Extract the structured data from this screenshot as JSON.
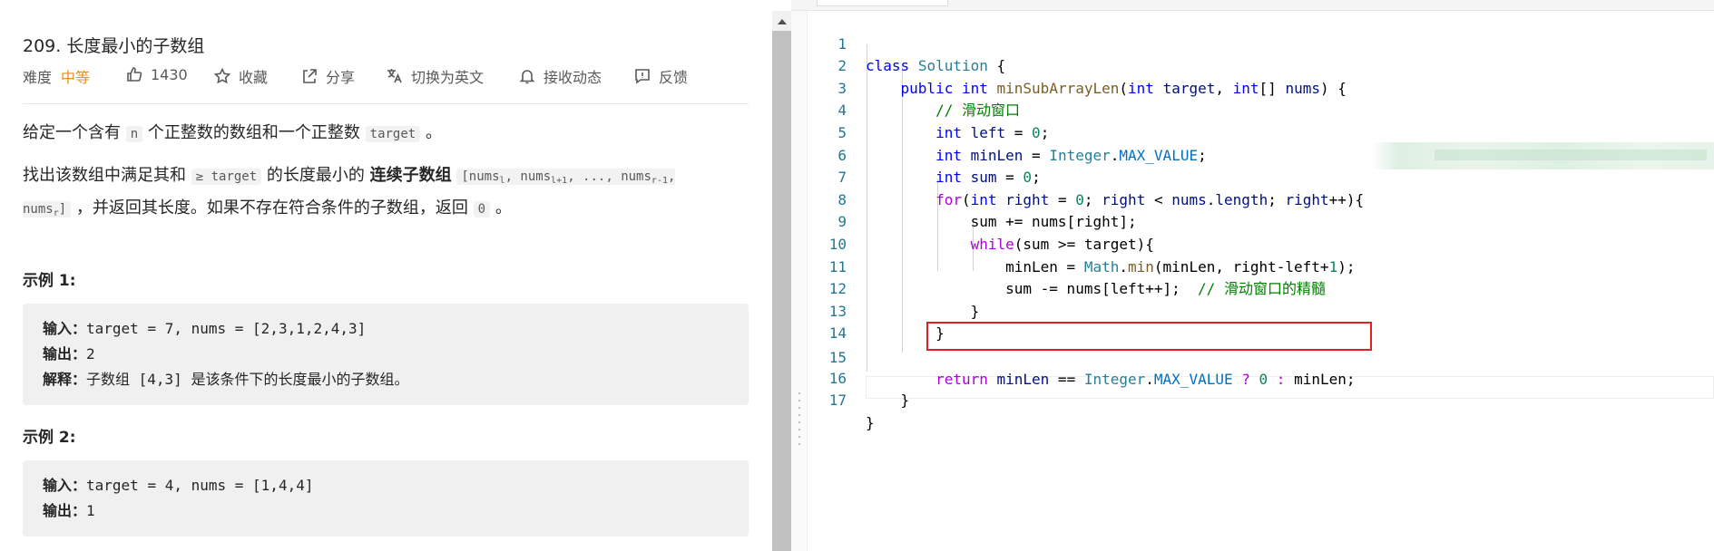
{
  "problem": {
    "title": "209. 长度最小的子数组",
    "difficulty_label": "难度",
    "difficulty_value": "中等",
    "likes": "1430",
    "favorite_label": "收藏",
    "share_label": "分享",
    "switch_lang_label": "切换为英文",
    "subscribe_label": "接收动态",
    "feedback_label": "反馈",
    "desc1": {
      "a": "给定一个含有",
      "n": "n",
      "b": "个正整数的数组和一个正整数",
      "target": "target",
      "c": "。"
    },
    "desc2": {
      "a": "找出该数组中满足其和",
      "cond": "≥ target",
      "b": "的长度最小的",
      "bold": "连续子数组",
      "seq_1": "[nums",
      "seq_1_sub": "l",
      "seq_2": ", nums",
      "seq_2_sub": "l+1",
      "seq_3": ", ..., nums",
      "seq_3_sub": "r-1",
      "seq_4": ", nums",
      "seq_4_sub": "r",
      "seq_5": "]",
      "c": "，并返回其长度。如果不存在符合条件的子数组，返回",
      "zero": "0",
      "d": "。"
    },
    "examples": [
      {
        "heading": "示例 1:",
        "input_label": "输入：",
        "input": "target = 7, nums = [2,3,1,2,4,3]",
        "output_label": "输出：",
        "output": "2",
        "explain_label": "解释：",
        "explain": "子数组 [4,3] 是该条件下的长度最小的子数组。"
      },
      {
        "heading": "示例 2:",
        "input_label": "输入：",
        "input": "target = 4, nums = [1,4,4]",
        "output_label": "输出：",
        "output": "1"
      }
    ]
  },
  "editor": {
    "lines": [
      {
        "no": "1"
      },
      {
        "no": "2"
      },
      {
        "no": "3"
      },
      {
        "no": "4"
      },
      {
        "no": "5"
      },
      {
        "no": "6"
      },
      {
        "no": "7"
      },
      {
        "no": "8"
      },
      {
        "no": "9"
      },
      {
        "no": "10"
      },
      {
        "no": "11"
      },
      {
        "no": "12"
      },
      {
        "no": "13"
      },
      {
        "no": "14"
      },
      {
        "no": "15"
      },
      {
        "no": "16"
      },
      {
        "no": "17"
      }
    ],
    "t": {
      "class": "class",
      "Solution": "Solution",
      "lbrace": " {",
      "public": "public",
      "int": "int",
      "minSub": "minSubArrayLen",
      "p_open": "(",
      "target": "target",
      "comma": ", ",
      "int_arr": "[]",
      "nums": "nums",
      "p_close_brace": ") {",
      "c_slide": "// 滑动窗口",
      "left": "left",
      "eq": " = ",
      "zero": "0",
      "semi": ";",
      "minLen": "minLen",
      "Integer": "Integer",
      "dot": ".",
      "MAX_VALUE": "MAX_VALUE",
      "sum": "sum",
      "for": "for",
      "right": "right",
      "lt": " < ",
      "length": "length",
      "rpp": "++){",
      "l8": "sum += nums[right];",
      "while": "while",
      "l9": "(sum >= target){",
      "Math": "Math",
      "min": "min",
      "l10_a": "(minLen, right-left+",
      "one": "1",
      "l10_b": ");",
      "l11": "sum -= nums[left++];  ",
      "c_essence": "// 滑动窗口的精髓",
      "rbrace": "}",
      "return": "return",
      "eqeq": " == ",
      "q": " ? ",
      "colon": " : ",
      "l15_end": "minLen;"
    }
  }
}
